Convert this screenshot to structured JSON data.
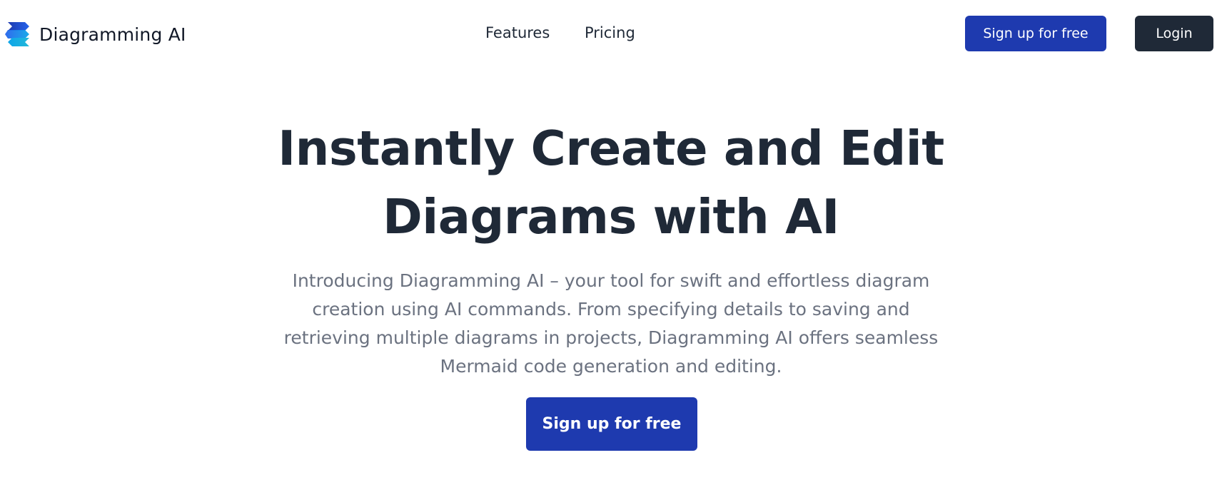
{
  "brand": {
    "name": "Diagramming AI",
    "logo_icon": "diagramming-ai-logo-icon",
    "logo_colors": [
      "#1e3aaf",
      "#2563eb",
      "#0ea5e9",
      "#22b8d9"
    ]
  },
  "nav": {
    "links": [
      {
        "label": "Features"
      },
      {
        "label": "Pricing"
      }
    ],
    "signup_label": "Sign up for free",
    "login_label": "Login"
  },
  "hero": {
    "title_lines": [
      "Instantly Create and Edit",
      "Diagrams with AI"
    ],
    "description_lines": [
      "Introducing Diagramming AI – your tool for swift and effortless diagram",
      "creation using AI commands. From specifying details to saving and",
      "retrieving multiple diagrams in projects, Diagramming AI offers seamless",
      "Mermaid code generation and editing."
    ],
    "cta_label": "Sign up for free"
  },
  "colors": {
    "primary": "#1e3aaf",
    "dark": "#1f2937",
    "muted_text": "#6b7280",
    "background": "#ffffff"
  }
}
